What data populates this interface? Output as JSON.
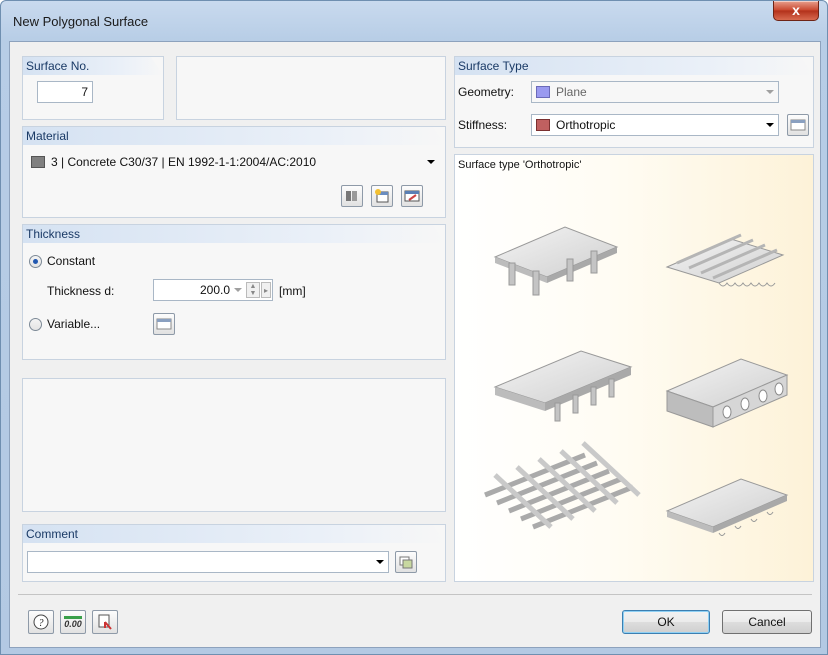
{
  "window": {
    "title": "New Polygonal Surface",
    "close_label": "x"
  },
  "surface_no": {
    "header": "Surface No.",
    "value": "7"
  },
  "material": {
    "header": "Material",
    "swatch_color": "#808080",
    "value": "3  |  Concrete C30/37  |  EN 1992-1-1:2004/AC:2010"
  },
  "thickness": {
    "header": "Thickness",
    "constant_label": "Constant",
    "thickness_label": "Thickness d:",
    "thickness_value": "200.0",
    "unit": "[mm]",
    "variable_label": "Variable...",
    "selected": "Constant"
  },
  "comment": {
    "header": "Comment",
    "value": ""
  },
  "surface_type": {
    "header": "Surface Type",
    "geometry_label": "Geometry:",
    "geometry_value": "Plane",
    "geometry_color": "#9a9af0",
    "stiffness_label": "Stiffness:",
    "stiffness_value": "Orthotropic",
    "stiffness_color": "#c06060"
  },
  "preview": {
    "caption": "Surface type 'Orthotropic'"
  },
  "footer": {
    "ok_label": "OK",
    "cancel_label": "Cancel",
    "units_icon_text": "0.00"
  },
  "icons": [
    "library-icon",
    "new-material-icon",
    "edit-icon",
    "help-icon",
    "units-icon",
    "pick-icon",
    "comment-library-icon"
  ]
}
